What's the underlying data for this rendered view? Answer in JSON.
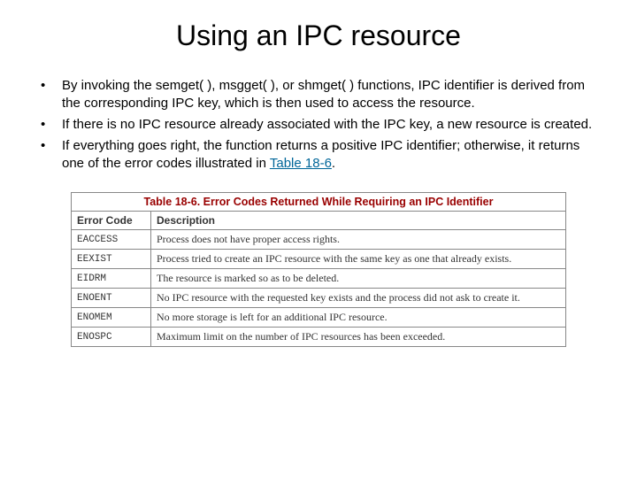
{
  "title": "Using an IPC resource",
  "bullets": [
    {
      "text_before_link": "By invoking the semget( ), msgget( ), or shmget( ) functions, IPC identifier is derived from the corresponding IPC key, which is then used to access the resource.",
      "link_text": "",
      "text_after_link": ""
    },
    {
      "text_before_link": "If there is no IPC resource already associated with the IPC key, a new resource is created.",
      "link_text": "",
      "text_after_link": ""
    },
    {
      "text_before_link": " If everything goes right, the function returns a positive IPC identifier; otherwise, it returns one of the error codes illustrated in ",
      "link_text": "Table 18-6",
      "text_after_link": "."
    }
  ],
  "table": {
    "caption": "Table 18-6. Error Codes Returned While Requiring an IPC Identifier",
    "headers": [
      "Error Code",
      "Description"
    ],
    "rows": [
      [
        "EACCESS",
        "Process does not have proper access rights."
      ],
      [
        "EEXIST",
        "Process tried to create an IPC resource with the same key as one that already exists."
      ],
      [
        "EIDRM",
        "The resource is marked so as to be deleted."
      ],
      [
        "ENOENT",
        "No IPC resource with the requested key exists and the process did not ask to create it."
      ],
      [
        "ENOMEM",
        "No more storage is left for an additional IPC resource."
      ],
      [
        "ENOSPC",
        "Maximum limit on the number of IPC resources has been exceeded."
      ]
    ]
  }
}
